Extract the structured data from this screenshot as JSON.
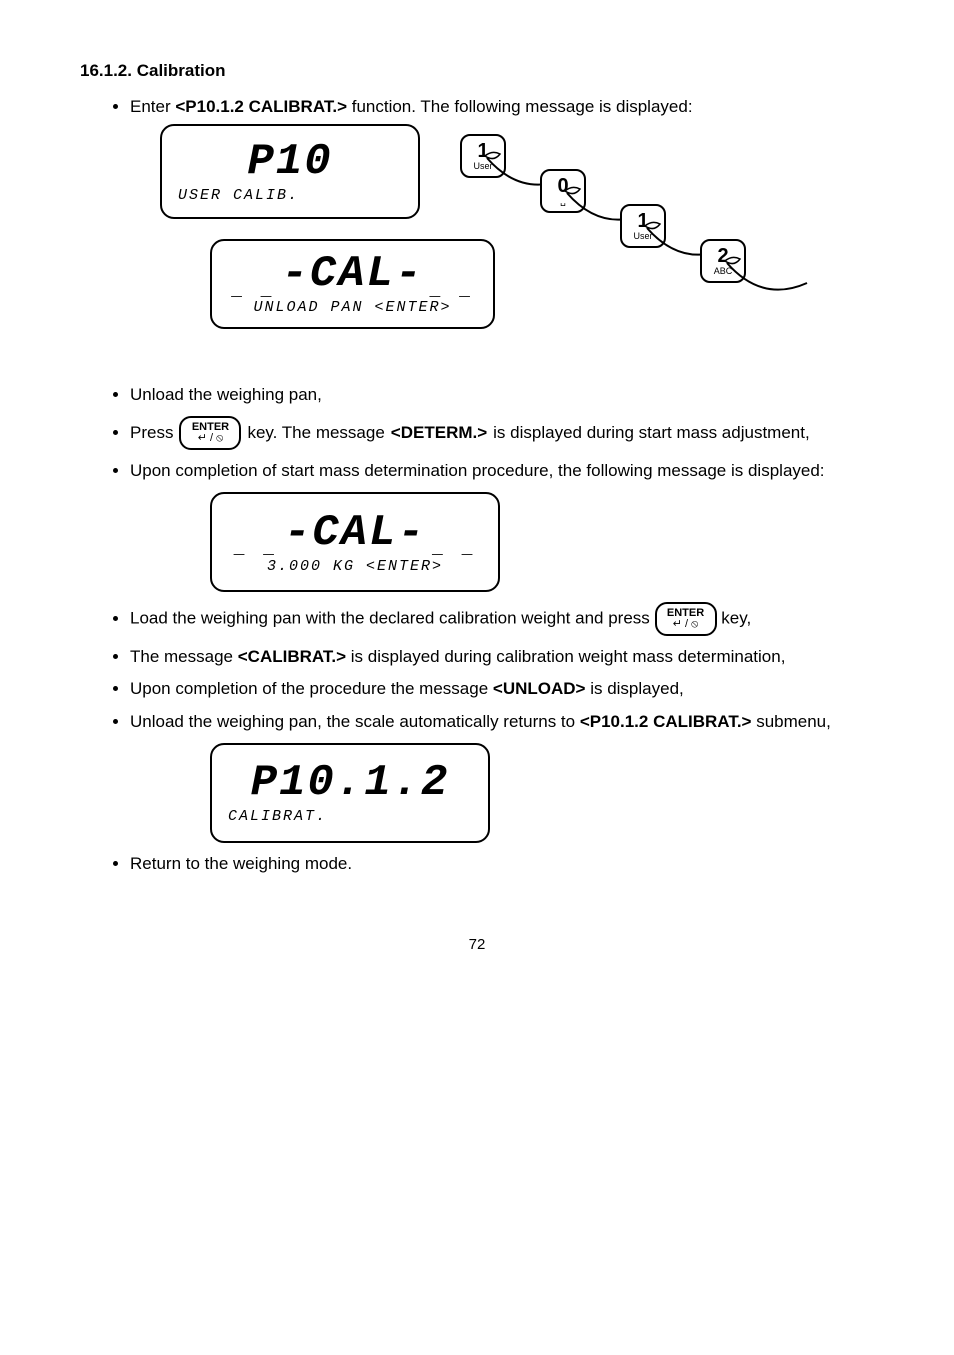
{
  "header_title": "16.1.2. Calibration",
  "steps": {
    "s1_a": "Enter ",
    "s1_b": "<P10.1.2 CALIBRAT.>",
    "s1_c": " function. The following message is displayed:",
    "s2": "Unload the weighing pan,",
    "s3_a": "Press ",
    "s3_b": " key. The message ",
    "s3_c": "<DETERM.>",
    "s3_d": " is displayed during start mass adjustment,",
    "s4": "Upon completion of start mass determination procedure, the following message is displayed:",
    "s5_a": "Load the weighing pan with the declared calibration weight and press ",
    "s5_b": " key,",
    "s6_a": "The message ",
    "s6_b": "<CALIBRAT.>",
    "s6_c": " is displayed during calibration weight mass determination,",
    "s7_a": "Upon completion of the procedure the message ",
    "s7_b": "<UNLOAD>",
    "s7_c": " is displayed,",
    "s8_a": "Unload the weighing pan, the scale automatically returns to ",
    "s8_b": "<P10.1.2 CALIBRAT.>",
    "s8_c": " submenu,",
    "s9": "Return to the weighing mode."
  },
  "lcd": {
    "p10_big": "P10",
    "p10_sub": "USER CALIB.",
    "cal_big": "-CAL-",
    "cal1_sub": "UNLOAD PAN  <ENTER>",
    "cal2_sub": "3.000 KG <ENTER>",
    "p1012_big": "P10.1.2",
    "p1012_sub": "CALIBRAT.",
    "dashes_side": "_ _",
    "dashes_full": "_ _  _ _  _ _  _ _  _ _"
  },
  "keypad": {
    "k1_top": "1",
    "k1_bot": "User",
    "k2_top": "0",
    "k2_bot": "␣",
    "k3_top": "1",
    "k3_bot": "User",
    "k4_top": "2",
    "k4_bot": "ABC"
  },
  "enter": {
    "top": "ENTER",
    "bot": "↵ / ⦸"
  },
  "footer": "72"
}
